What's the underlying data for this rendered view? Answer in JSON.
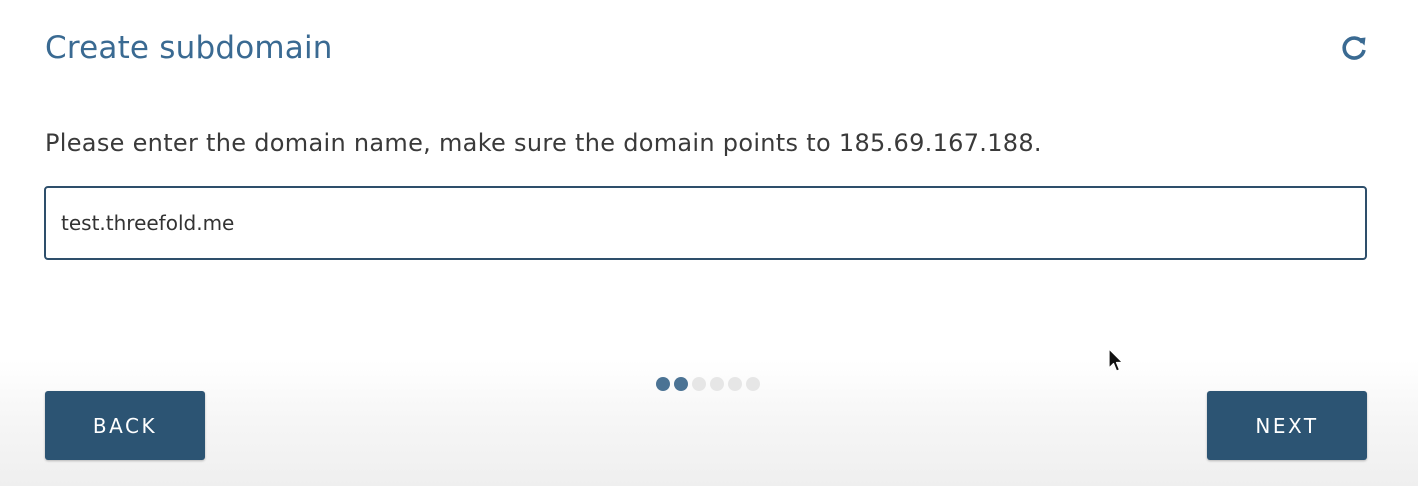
{
  "header": {
    "title": "Create subdomain",
    "refresh_icon": "refresh-icon"
  },
  "form": {
    "instruction": "Please enter the domain name, make sure the domain points to 185.69.167.188.",
    "domain_value": "test.threefold.me"
  },
  "stepper": {
    "total_steps": 6,
    "current_step": 2
  },
  "footer": {
    "back_label": "BACK",
    "next_label": "NEXT"
  },
  "colors": {
    "title": "#3a6a92",
    "button": "#2c5473",
    "input_border": "#2e4f6b",
    "dot_active": "#4b7394",
    "dot_inactive": "#e6e6e6"
  }
}
